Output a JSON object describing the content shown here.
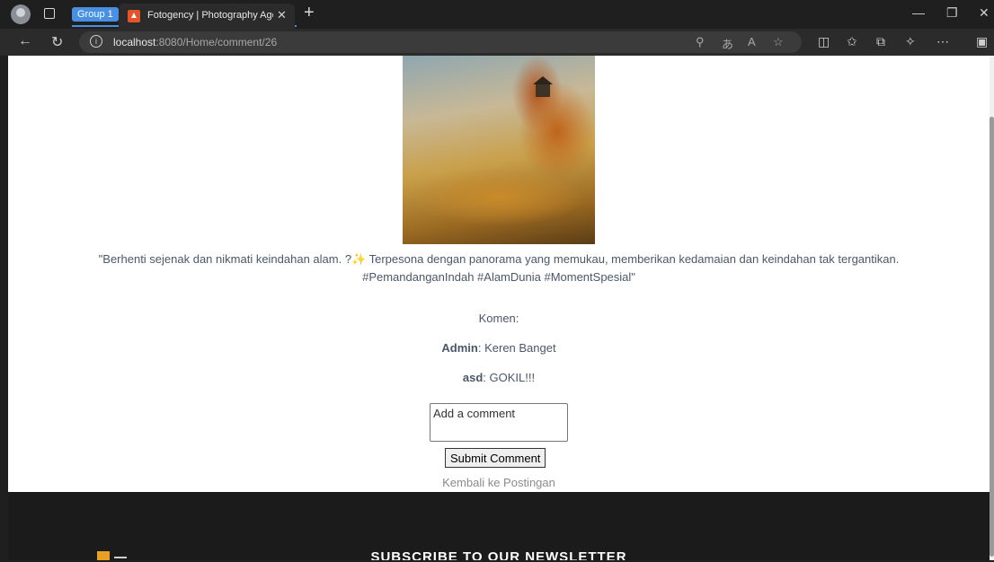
{
  "browser": {
    "tab_group": "Group 1",
    "tab_title": "Fotogency | Photography Agency",
    "url_host": "localhost",
    "url_path": ":8080/Home/comment/26"
  },
  "post": {
    "caption_line1": "\"Berhenti sejenak dan nikmati keindahan alam. ?✨ Terpesona dengan panorama yang memukau, memberikan kedamaian dan keindahan tak tergantikan.",
    "caption_line2": "#PemandanganIndah #AlamDunia #MomentSpesial\""
  },
  "comments": {
    "label": "Komen:",
    "items": [
      {
        "author": "Admin",
        "text": ": Keren Banget"
      },
      {
        "author": "asd",
        "text": ": GOKIL!!!"
      }
    ]
  },
  "form": {
    "placeholder": "Add a comment",
    "submit_label": "Submit Comment"
  },
  "back_link": "Kembali ke Postingan",
  "footer": {
    "newsletter_title": "SUBSCRIBE TO OUR NEWSLETTER"
  },
  "icons": {
    "accent_group": "#4a90e2",
    "favicon": "#e3542a"
  }
}
